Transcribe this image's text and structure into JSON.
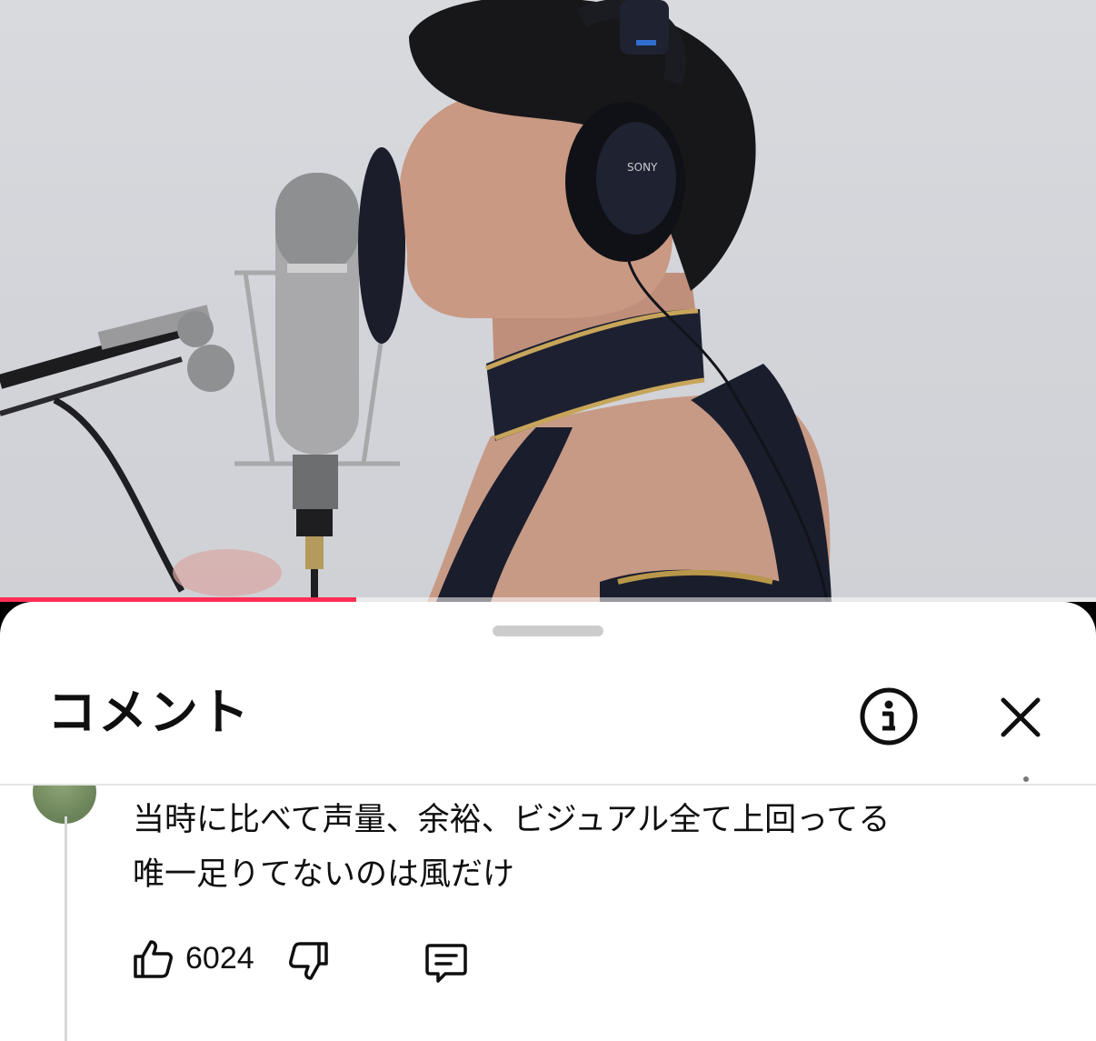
{
  "video": {
    "progress_fraction": 0.325,
    "progress_color": "#ff2d55",
    "headphone_brand": "SONY"
  },
  "comments_sheet": {
    "title": "コメント",
    "info_icon": "info-circle-icon",
    "close_icon": "close-icon"
  },
  "comment": {
    "lines": [
      "当時に比べて声量、余裕、ビジュアル全て上回ってる",
      "唯一足りてないのは風だけ"
    ],
    "like_count": "6024",
    "like_icon": "thumbs-up-icon",
    "dislike_icon": "thumbs-down-icon",
    "reply_icon": "reply-comment-icon"
  }
}
